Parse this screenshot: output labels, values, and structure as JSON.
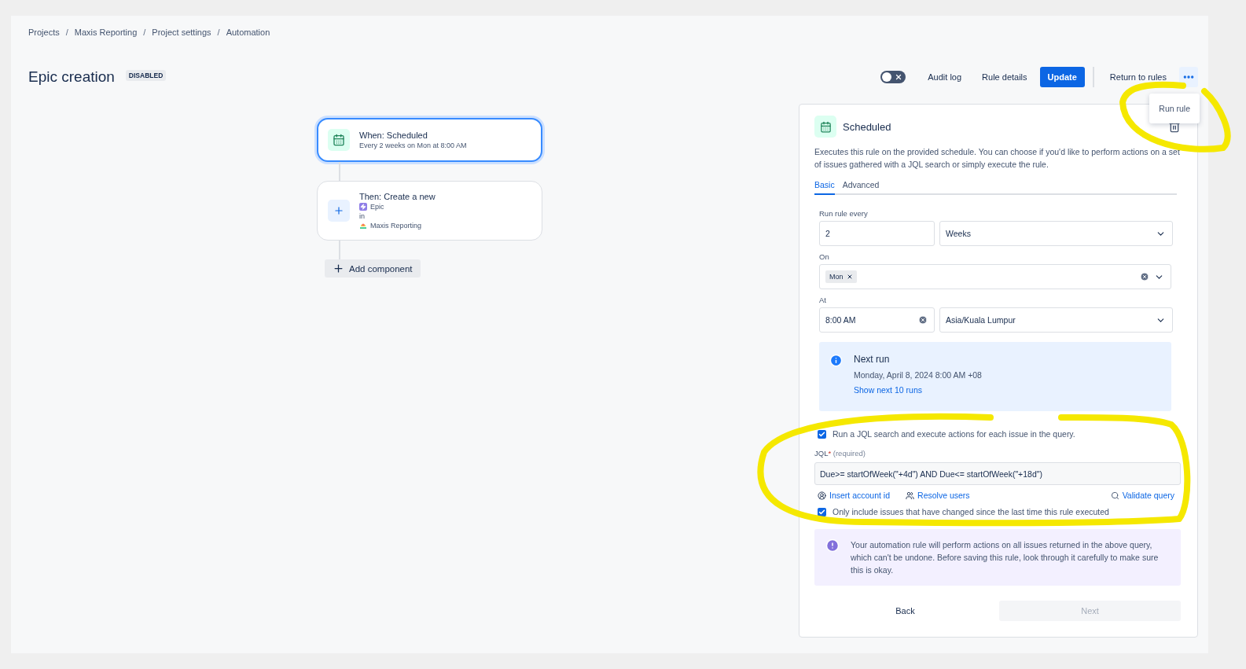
{
  "breadcrumbs": [
    "Projects",
    "Maxis Reporting",
    "Project settings",
    "Automation"
  ],
  "breadcrumb_separator": "/",
  "title": "Epic creation",
  "status_badge": "DISABLED",
  "toolbar": {
    "rule_toggle": {
      "on": false
    },
    "audit_log": "Audit log",
    "rule_details": "Rule details",
    "update": "Update",
    "return": "Return to rules",
    "more_menu": {
      "expanded": true,
      "items": [
        "Run rule"
      ]
    }
  },
  "flow": {
    "trigger": {
      "title": "When: Scheduled",
      "subtitle": "Every 2 weeks on Mon at 8:00 AM",
      "selected": true
    },
    "action": {
      "title": "Then: Create a new",
      "issue_type": "Epic",
      "joiner": "in",
      "project": "Maxis Reporting",
      "selected": false
    },
    "add_component": "Add component"
  },
  "panel": {
    "title": "Scheduled",
    "description": "Executes this rule on the provided schedule. You can choose if you'd like to perform actions on a set of issues gathered with a JQL search or simply execute the rule.",
    "tabs": [
      {
        "label": "Basic",
        "selected": true
      },
      {
        "label": "Advanced",
        "selected": false
      }
    ],
    "run_every": {
      "label": "Run rule every",
      "value": "2",
      "unit": "Weeks"
    },
    "on": {
      "label": "On",
      "tags": [
        "Mon"
      ]
    },
    "at": {
      "label": "At",
      "time": "8:00 AM",
      "timezone": "Asia/Kuala Lumpur"
    },
    "next_run": {
      "title": "Next run",
      "date": "Monday, April 8, 2024 8:00 AM +08",
      "link": "Show next 10 runs"
    },
    "jql_toggle": {
      "label": "Run a JQL search and execute actions for each issue in the query.",
      "checked": true
    },
    "jql": {
      "label": "JQL",
      "required_mark": "*",
      "hint": "(required)",
      "value": "Due>= startOfWeek(\"+4d\") AND Due<= startOfWeek(\"+18d\")"
    },
    "jql_links": [
      "Insert account id",
      "Resolve users",
      "Validate query"
    ],
    "changed_only": {
      "label": "Only include issues that have changed since the last time this rule executed",
      "checked": true
    },
    "warning": "Your automation rule will perform actions on all issues returned in the above query, which can't be undone. Before saving this rule, look through it carefully to make sure this is okay.",
    "back": "Back",
    "next": {
      "label": "Next",
      "disabled": true
    }
  },
  "annotations": [
    {
      "kind": "highlight"
    },
    {
      "kind": "highlight"
    }
  ]
}
